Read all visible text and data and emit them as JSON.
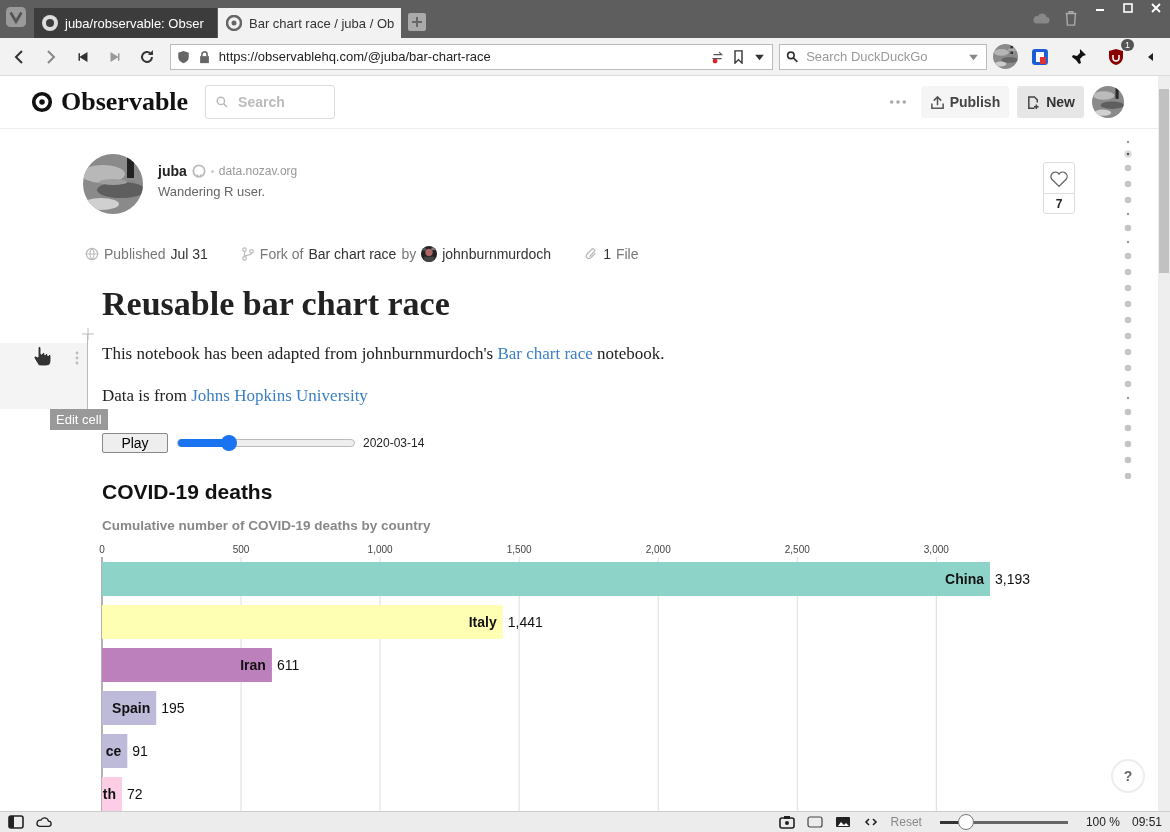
{
  "browser": {
    "tabs": [
      {
        "title": "juba/robservable: Obser",
        "selected": false
      },
      {
        "title": "Bar chart race / juba / Ob",
        "selected": true
      }
    ],
    "url": "https://observablehq.com/@juba/bar-chart-race",
    "search": {
      "placeholder": "Search DuckDuckGo"
    },
    "extension_badge": "1"
  },
  "header": {
    "logo": "Observable",
    "search": {
      "placeholder": "Search"
    },
    "publish": "Publish",
    "new": "New"
  },
  "author": {
    "name": "juba",
    "site": "data.nozav.org",
    "bio": "Wandering R user."
  },
  "meta": {
    "published_label": "Published",
    "published_date": "Jul 31",
    "fork_label": "Fork of",
    "fork_title": "Bar chart race",
    "by": "by",
    "fork_author": "johnburnmurdoch",
    "files_count": "1",
    "files_label": "File"
  },
  "likes": "7",
  "notebook": {
    "title": "Reusable bar chart race",
    "intro": {
      "before": "This notebook has been adapted from johnburnmurdoch's ",
      "link": "Bar chart race",
      "after": " notebook."
    },
    "source": {
      "before": "Data is from ",
      "link": "Johns Hopkins University"
    },
    "tooltip": "Edit cell",
    "play_button": "Play",
    "slider": {
      "level": 0.29
    },
    "date": "2020-03-14",
    "chart_heading": "COVID-19 deaths",
    "chart_data": {
      "type": "bar",
      "orientation": "horizontal",
      "title": "Cumulative number of COVID-19 deaths by country",
      "categories": [
        "China",
        "Italy",
        "Iran",
        "Spain",
        "ce",
        "th"
      ],
      "colors": [
        "#8dd3c7",
        "#ffffb3",
        "#bc80bd",
        "#bebada",
        "#bebada",
        "#fccde5"
      ],
      "values": [
        3193,
        1441,
        611,
        195,
        91,
        72
      ],
      "xticks": [
        0,
        {
          "value": 500,
          "label": "500"
        },
        {
          "value": 1000,
          "label": "1,000"
        },
        {
          "value": 1500,
          "label": "1,500"
        },
        {
          "value": 2000,
          "label": "2,000"
        },
        {
          "value": 2500,
          "label": "2,500"
        },
        {
          "value": 3000,
          "label": "3,000"
        }
      ],
      "xlim": [
        0,
        3193
      ],
      "grid": true,
      "value_labels": [
        "3,193",
        "1,441",
        "611",
        "195",
        "91",
        "72"
      ]
    }
  },
  "help": "?",
  "status_bar": {
    "reset": "Reset",
    "zoom": {
      "level": 0.2
    },
    "zoom_value": "100 %",
    "time": "09:51"
  }
}
